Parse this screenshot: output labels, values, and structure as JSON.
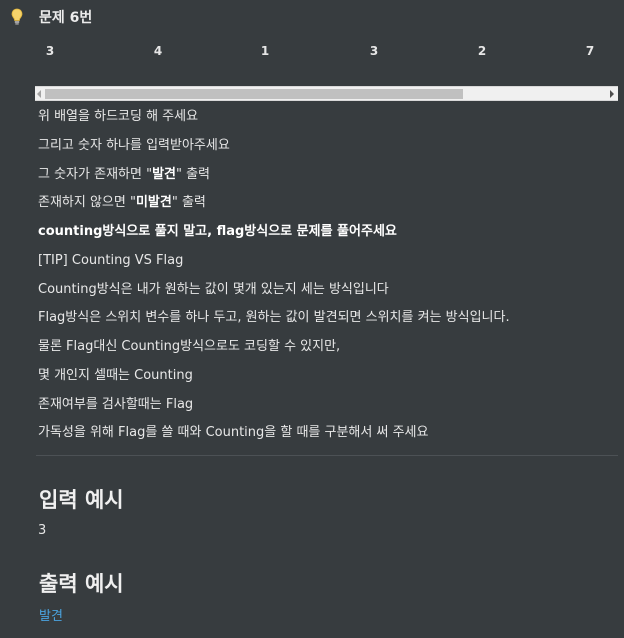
{
  "callout": {
    "icon": "lightbulb-icon",
    "title": "문제 6번"
  },
  "array_row": [
    "3",
    "4",
    "1",
    "3",
    "2",
    "7"
  ],
  "lines": [
    {
      "parts": [
        {
          "t": "위 배열을 하드코딩 해 주세요",
          "b": false
        }
      ]
    },
    {
      "parts": [
        {
          "t": "그리고 숫자 하나를 입력받아주세요",
          "b": false
        }
      ]
    },
    {
      "parts": [
        {
          "t": "그 숫자가 존재하면 \"",
          "b": false
        },
        {
          "t": "발견",
          "b": true
        },
        {
          "t": "\" 출력",
          "b": false
        }
      ]
    },
    {
      "parts": [
        {
          "t": "존재하지 않으면 \"",
          "b": false
        },
        {
          "t": "미발견",
          "b": true
        },
        {
          "t": "\" 출력",
          "b": false
        }
      ]
    },
    {
      "parts": [
        {
          "t": "counting방식으로 풀지 말고, flag방식으로 문제를 풀어주세요",
          "b": true
        }
      ]
    },
    {
      "parts": [
        {
          "t": "[TIP] Counting VS Flag",
          "b": false
        }
      ]
    },
    {
      "parts": [
        {
          "t": "Counting방식은 내가 원하는 값이 몇개 있는지 세는 방식입니다",
          "b": false
        }
      ]
    },
    {
      "parts": [
        {
          "t": "Flag방식은 스위치 변수를 하나 두고, 원하는 값이 발견되면 스위치를 켜는 방식입니다.",
          "b": false
        }
      ]
    },
    {
      "parts": [
        {
          "t": "물론 Flag대신 Counting방식으로도 코딩할 수 있지만,",
          "b": false
        }
      ]
    },
    {
      "parts": [
        {
          "t": "몇 개인지 셀때는 Counting",
          "b": false
        }
      ]
    },
    {
      "parts": [
        {
          "t": "존재여부를 검사할때는 Flag",
          "b": false
        }
      ]
    },
    {
      "parts": [
        {
          "t": "가독성을 위해 Flag를 쓸 때와 Counting을 할 때를 구분해서 써 주세요",
          "b": false
        }
      ]
    }
  ],
  "input_example": {
    "heading": "입력 예시",
    "value": "3"
  },
  "output_example": {
    "heading": "출력 예시",
    "value": "발견"
  },
  "colors": {
    "background": "#373c3f",
    "link": "#4aa3df"
  }
}
